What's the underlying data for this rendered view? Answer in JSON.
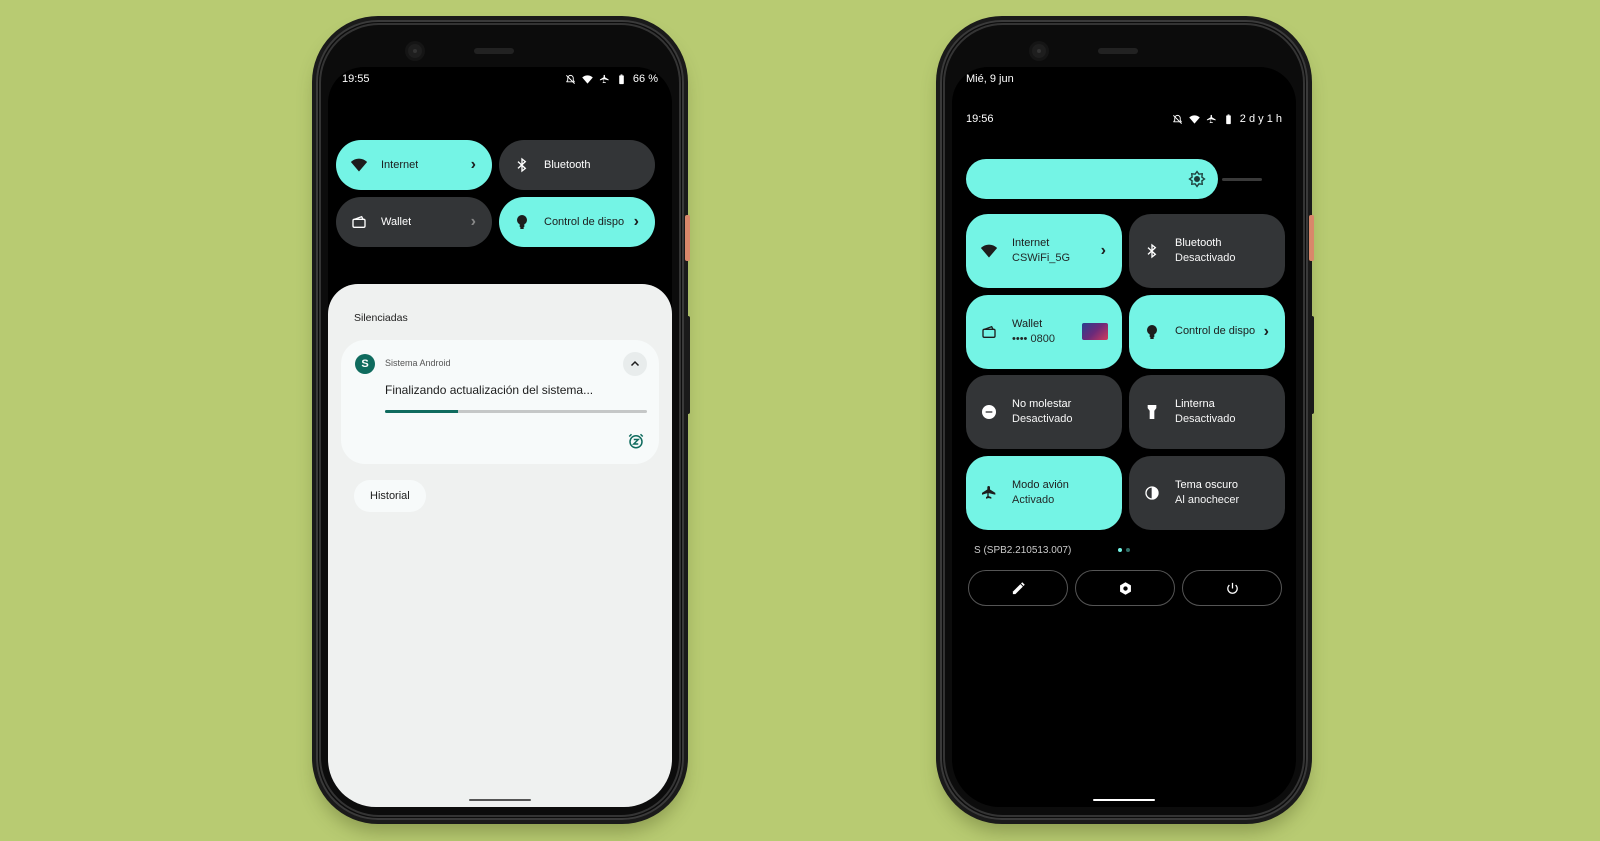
{
  "colors": {
    "background": "#b8cb72",
    "tile_active": "#74f4e5",
    "tile_inactive": "#333537",
    "accent_dark_teal": "#0f6b5e",
    "shade_light": "#eff1f0"
  },
  "left_phone": {
    "status": {
      "time": "19:55",
      "battery": "66 %",
      "icons": [
        "silent-icon",
        "wifi-icon",
        "airplane-icon",
        "battery-icon"
      ]
    },
    "quick_tiles": [
      {
        "label": "Internet",
        "icon": "wifi-icon",
        "active": true,
        "chevron": true
      },
      {
        "label": "Bluetooth",
        "icon": "bluetooth-icon",
        "active": false,
        "chevron": false
      },
      {
        "label": "Wallet",
        "icon": "wallet-icon",
        "active": false,
        "chevron": true
      },
      {
        "label": "Control de dispo",
        "icon": "lightbulb-icon",
        "active": true,
        "chevron": true
      }
    ],
    "notifications": {
      "section_title": "Silenciadas",
      "card": {
        "app_name": "Sistema Android",
        "app_icon_glyph": "S",
        "title": "Finalizando actualización del sistema...",
        "progress": 0.28
      },
      "history_button": "Historial"
    }
  },
  "right_phone": {
    "date": "Mié, 9 jun",
    "status": {
      "time": "19:56",
      "battery": "2 d y 1 h",
      "icons": [
        "silent-icon",
        "wifi-icon",
        "airplane-icon",
        "battery-icon"
      ]
    },
    "brightness": 0.85,
    "tiles": [
      {
        "title": "Internet",
        "subtitle": "CSWiFi_5G",
        "icon": "wifi-icon",
        "active": true,
        "chevron": true
      },
      {
        "title": "Bluetooth",
        "subtitle": "Desactivado",
        "icon": "bluetooth-icon",
        "active": false,
        "chevron": false
      },
      {
        "title": "Wallet",
        "subtitle": "•••• 0800",
        "icon": "wallet-icon",
        "active": true,
        "chevron": false,
        "card_thumbnail": true
      },
      {
        "title": "Control de dispo",
        "subtitle": "",
        "icon": "lightbulb-icon",
        "active": true,
        "chevron": true
      },
      {
        "title": "No molestar",
        "subtitle": "Desactivado",
        "icon": "do-not-disturb-icon",
        "active": false,
        "chevron": false
      },
      {
        "title": "Linterna",
        "subtitle": "Desactivado",
        "icon": "flashlight-icon",
        "active": false,
        "chevron": false
      },
      {
        "title": "Modo avión",
        "subtitle": "Activado",
        "icon": "airplane-icon",
        "active": true,
        "chevron": false
      },
      {
        "title": "Tema oscuro",
        "subtitle": "Al anochecer",
        "icon": "dark-theme-icon",
        "active": false,
        "chevron": false
      }
    ],
    "build_number": "S (SPB2.210513.007)",
    "page_indicator": {
      "pages": 2,
      "current": 1
    },
    "footer_buttons": [
      {
        "name": "edit",
        "icon": "pencil-icon"
      },
      {
        "name": "settings",
        "icon": "gear-icon"
      },
      {
        "name": "power",
        "icon": "power-icon"
      }
    ]
  }
}
